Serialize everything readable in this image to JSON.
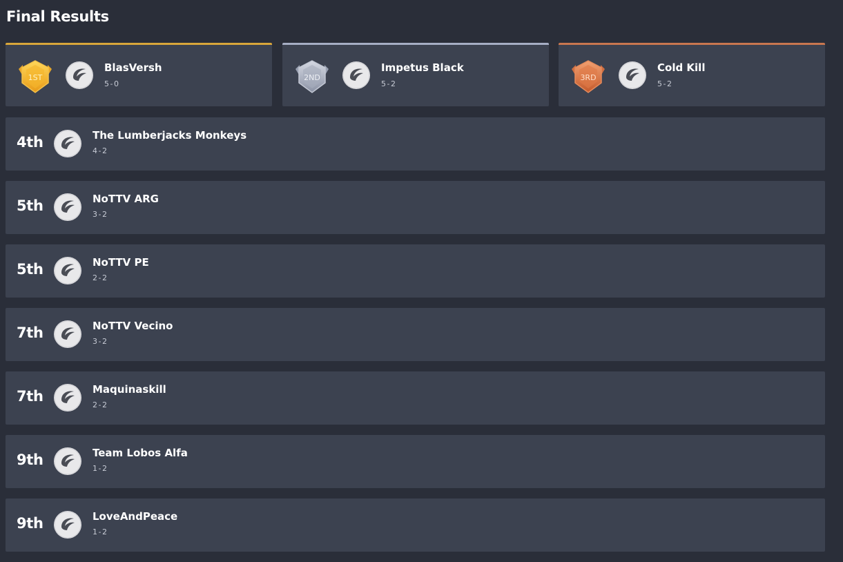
{
  "page": {
    "title": "Final Results"
  },
  "colors": {
    "background": "#2a2e39",
    "card": "#3c4250",
    "gold": "#d9a63a",
    "silver": "#a6aec4",
    "bronze": "#c9774f"
  },
  "podium": [
    {
      "medal_label": "1ST",
      "medal_icon": "gold-medal-icon",
      "team_icon": "team-logo-icon",
      "name": "BlasVersh",
      "record": "5-0"
    },
    {
      "medal_label": "2ND",
      "medal_icon": "silver-medal-icon",
      "team_icon": "team-logo-icon",
      "name": "Impetus Black",
      "record": "5-2"
    },
    {
      "medal_label": "3RD",
      "medal_icon": "bronze-medal-icon",
      "team_icon": "team-logo-icon",
      "name": "Cold Kill",
      "record": "5-2"
    }
  ],
  "standings": [
    {
      "rank": "4th",
      "name": "The Lumberjacks Monkeys",
      "record": "4-2"
    },
    {
      "rank": "5th",
      "name": "NoTTV ARG",
      "record": "3-2"
    },
    {
      "rank": "5th",
      "name": "NoTTV PE",
      "record": "2-2"
    },
    {
      "rank": "7th",
      "name": "NoTTV Vecino",
      "record": "3-2"
    },
    {
      "rank": "7th",
      "name": "Maquinaskill",
      "record": "2-2"
    },
    {
      "rank": "9th",
      "name": "Team Lobos Alfa",
      "record": "1-2"
    },
    {
      "rank": "9th",
      "name": "LoveAndPeace",
      "record": "1-2"
    }
  ]
}
